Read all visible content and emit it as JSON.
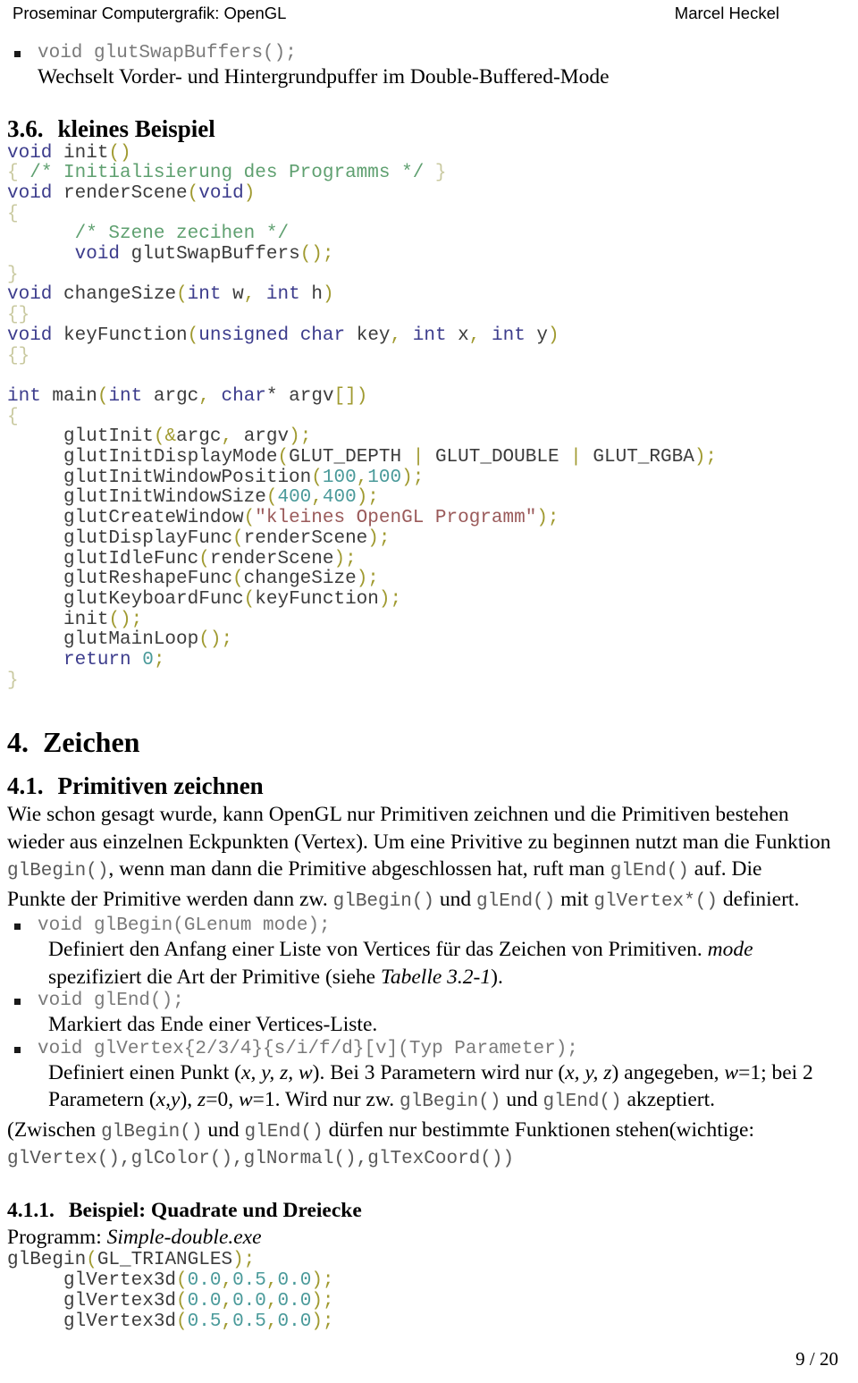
{
  "header": {
    "left": "Proseminar Computergrafik: OpenGL",
    "right": "Marcel Heckel"
  },
  "footer": {
    "page_indicator": "9 / 20"
  },
  "top_bullet": {
    "signature": "void glutSwapBuffers();",
    "description": "Wechselt Vorder- und Hintergrundpuffer im Double-Buffered-Mode"
  },
  "section_3_6": {
    "number": "3.6.",
    "title": "kleines Beispiel",
    "code_lines": [
      [
        {
          "t": "void",
          "c": "kw"
        },
        {
          "t": " ",
          "c": "plain"
        },
        {
          "t": "init",
          "c": "id"
        },
        {
          "t": "()",
          "c": "pun"
        }
      ],
      [
        {
          "t": "{",
          "c": "brc"
        },
        {
          "t": " ",
          "c": "plain"
        },
        {
          "t": "/* Initialisierung des Programms */",
          "c": "cmt"
        },
        {
          "t": " ",
          "c": "plain"
        },
        {
          "t": "}",
          "c": "brc"
        }
      ],
      [
        {
          "t": "void",
          "c": "kw"
        },
        {
          "t": " ",
          "c": "plain"
        },
        {
          "t": "renderScene",
          "c": "id"
        },
        {
          "t": "(",
          "c": "pun"
        },
        {
          "t": "void",
          "c": "kw"
        },
        {
          "t": ")",
          "c": "pun"
        }
      ],
      [
        {
          "t": "{",
          "c": "brc"
        }
      ],
      [
        {
          "t": "      ",
          "c": "plain"
        },
        {
          "t": "/* Szene zecihen */",
          "c": "cmt"
        }
      ],
      [
        {
          "t": "      ",
          "c": "plain"
        },
        {
          "t": "void",
          "c": "kw"
        },
        {
          "t": " ",
          "c": "plain"
        },
        {
          "t": "glutSwapBuffers",
          "c": "id"
        },
        {
          "t": "()",
          "c": "pun"
        },
        {
          "t": ";",
          "c": "pun"
        }
      ],
      [
        {
          "t": "}",
          "c": "brc"
        }
      ],
      [
        {
          "t": "void",
          "c": "kw"
        },
        {
          "t": " ",
          "c": "plain"
        },
        {
          "t": "changeSize",
          "c": "id"
        },
        {
          "t": "(",
          "c": "pun"
        },
        {
          "t": "int",
          "c": "kw"
        },
        {
          "t": " w",
          "c": "id"
        },
        {
          "t": ",",
          "c": "pun"
        },
        {
          "t": " ",
          "c": "plain"
        },
        {
          "t": "int",
          "c": "kw"
        },
        {
          "t": " h",
          "c": "id"
        },
        {
          "t": ")",
          "c": "pun"
        }
      ],
      [
        {
          "t": "{}",
          "c": "brc"
        }
      ],
      [
        {
          "t": "void",
          "c": "kw"
        },
        {
          "t": " ",
          "c": "plain"
        },
        {
          "t": "keyFunction",
          "c": "id"
        },
        {
          "t": "(",
          "c": "pun"
        },
        {
          "t": "unsigned",
          "c": "kw"
        },
        {
          "t": " ",
          "c": "plain"
        },
        {
          "t": "char",
          "c": "kw"
        },
        {
          "t": " key",
          "c": "id"
        },
        {
          "t": ",",
          "c": "pun"
        },
        {
          "t": " ",
          "c": "plain"
        },
        {
          "t": "int",
          "c": "kw"
        },
        {
          "t": " x",
          "c": "id"
        },
        {
          "t": ",",
          "c": "pun"
        },
        {
          "t": " ",
          "c": "plain"
        },
        {
          "t": "int",
          "c": "kw"
        },
        {
          "t": " y",
          "c": "id"
        },
        {
          "t": ")",
          "c": "pun"
        }
      ],
      [
        {
          "t": "{}",
          "c": "brc"
        }
      ],
      [
        {
          "t": "",
          "c": "plain"
        }
      ],
      [
        {
          "t": "int",
          "c": "kw"
        },
        {
          "t": " ",
          "c": "plain"
        },
        {
          "t": "main",
          "c": "id"
        },
        {
          "t": "(",
          "c": "pun"
        },
        {
          "t": "int",
          "c": "kw"
        },
        {
          "t": " argc",
          "c": "id"
        },
        {
          "t": ",",
          "c": "pun"
        },
        {
          "t": " ",
          "c": "plain"
        },
        {
          "t": "char",
          "c": "kw"
        },
        {
          "t": "*",
          "c": "id"
        },
        {
          "t": " argv",
          "c": "id"
        },
        {
          "t": "[]",
          "c": "pun"
        },
        {
          "t": ")",
          "c": "pun"
        }
      ],
      [
        {
          "t": "{",
          "c": "brc"
        }
      ],
      [
        {
          "t": "     ",
          "c": "plain"
        },
        {
          "t": "glutInit",
          "c": "id"
        },
        {
          "t": "(",
          "c": "pun"
        },
        {
          "t": "&",
          "c": "pun"
        },
        {
          "t": "argc",
          "c": "id"
        },
        {
          "t": ",",
          "c": "pun"
        },
        {
          "t": " argv",
          "c": "id"
        },
        {
          "t": ");",
          "c": "pun"
        }
      ],
      [
        {
          "t": "     ",
          "c": "plain"
        },
        {
          "t": "glutInitDisplayMode",
          "c": "id"
        },
        {
          "t": "(",
          "c": "pun"
        },
        {
          "t": "GLUT_DEPTH",
          "c": "id"
        },
        {
          "t": " ",
          "c": "plain"
        },
        {
          "t": "|",
          "c": "pun"
        },
        {
          "t": " ",
          "c": "plain"
        },
        {
          "t": "GLUT_DOUBLE",
          "c": "id"
        },
        {
          "t": " ",
          "c": "plain"
        },
        {
          "t": "|",
          "c": "pun"
        },
        {
          "t": " ",
          "c": "plain"
        },
        {
          "t": "GLUT_RGBA",
          "c": "id"
        },
        {
          "t": ");",
          "c": "pun"
        }
      ],
      [
        {
          "t": "     ",
          "c": "plain"
        },
        {
          "t": "glutInitWindowPosition",
          "c": "id"
        },
        {
          "t": "(",
          "c": "pun"
        },
        {
          "t": "100",
          "c": "num"
        },
        {
          "t": ",",
          "c": "pun"
        },
        {
          "t": "100",
          "c": "num"
        },
        {
          "t": ");",
          "c": "pun"
        }
      ],
      [
        {
          "t": "     ",
          "c": "plain"
        },
        {
          "t": "glutInitWindowSize",
          "c": "id"
        },
        {
          "t": "(",
          "c": "pun"
        },
        {
          "t": "400",
          "c": "num"
        },
        {
          "t": ",",
          "c": "pun"
        },
        {
          "t": "400",
          "c": "num"
        },
        {
          "t": ");",
          "c": "pun"
        }
      ],
      [
        {
          "t": "     ",
          "c": "plain"
        },
        {
          "t": "glutCreateWindow",
          "c": "id"
        },
        {
          "t": "(",
          "c": "pun"
        },
        {
          "t": "\"kleines OpenGL Programm\"",
          "c": "str"
        },
        {
          "t": ");",
          "c": "pun"
        }
      ],
      [
        {
          "t": "     ",
          "c": "plain"
        },
        {
          "t": "glutDisplayFunc",
          "c": "id"
        },
        {
          "t": "(",
          "c": "pun"
        },
        {
          "t": "renderScene",
          "c": "id"
        },
        {
          "t": ");",
          "c": "pun"
        }
      ],
      [
        {
          "t": "     ",
          "c": "plain"
        },
        {
          "t": "glutIdleFunc",
          "c": "id"
        },
        {
          "t": "(",
          "c": "pun"
        },
        {
          "t": "renderScene",
          "c": "id"
        },
        {
          "t": ");",
          "c": "pun"
        }
      ],
      [
        {
          "t": "     ",
          "c": "plain"
        },
        {
          "t": "glutReshapeFunc",
          "c": "id"
        },
        {
          "t": "(",
          "c": "pun"
        },
        {
          "t": "changeSize",
          "c": "id"
        },
        {
          "t": ");",
          "c": "pun"
        }
      ],
      [
        {
          "t": "     ",
          "c": "plain"
        },
        {
          "t": "glutKeyboardFunc",
          "c": "id"
        },
        {
          "t": "(",
          "c": "pun"
        },
        {
          "t": "keyFunction",
          "c": "id"
        },
        {
          "t": ");",
          "c": "pun"
        }
      ],
      [
        {
          "t": "     ",
          "c": "plain"
        },
        {
          "t": "init",
          "c": "id"
        },
        {
          "t": "();",
          "c": "pun"
        }
      ],
      [
        {
          "t": "     ",
          "c": "plain"
        },
        {
          "t": "glutMainLoop",
          "c": "id"
        },
        {
          "t": "();",
          "c": "pun"
        }
      ],
      [
        {
          "t": "     ",
          "c": "plain"
        },
        {
          "t": "return",
          "c": "kw"
        },
        {
          "t": " ",
          "c": "plain"
        },
        {
          "t": "0",
          "c": "num"
        },
        {
          "t": ";",
          "c": "pun"
        }
      ],
      [
        {
          "t": "}",
          "c": "brc"
        }
      ]
    ]
  },
  "section_4": {
    "number": "4.",
    "title": "Zeichen"
  },
  "section_4_1": {
    "number": "4.1.",
    "title": "Primitiven zeichnen",
    "paragraph": {
      "line1": "Wie schon gesagt wurde, kann OpenGL nur Primitiven zeichnen und die Primitiven bestehen",
      "line2_a": "wieder aus einzelnen Eckpunkten (Vertex). Um eine Privitive zu beginnen nutzt man die Funktion",
      "line3_code1": "glBegin()",
      "line3_a": ", wenn man dann die Primitive abgeschlossen hat, ruft man ",
      "line3_code2": "glEnd()",
      "line3_b": " auf. Die",
      "line4_a": "Punkte der Primitive werden dann zw. ",
      "line4_code1": "glBegin()",
      "line4_b": " und ",
      "line4_code2": "glEnd()",
      "line4_c": " mit ",
      "line4_code3": "glVertex*()",
      "line4_d": " definiert."
    },
    "bullets": [
      {
        "signature": "void glBegin(GLenum mode);",
        "desc_a": "Definiert den Anfang einer Liste von Vertices für das Zeichen von Primitiven. ",
        "desc_italic1": "mode",
        "desc_b": "spezifiziert die Art der Primitive (siehe ",
        "desc_italic2": "Tabelle 3.2-1",
        "desc_c": ")."
      },
      {
        "signature": "void glEnd();",
        "desc_a": "Markiert das Ende einer Vertices-Liste.",
        "desc_italic1": "",
        "desc_b": "",
        "desc_italic2": "",
        "desc_c": ""
      },
      {
        "signature": "void glVertex{2/3/4}{s/i/f/d}[v](Typ Parameter);",
        "desc_a": "Definiert einen Punkt (",
        "desc_italic1": "x, y, z, w",
        "desc_b": "). Bei 3 Parametern wird nur (",
        "desc_italic2": "x, y, z",
        "desc_c": ") angegeben, "
      }
    ],
    "vertex_detail": {
      "w_eq": "w",
      "w_val": "=1; bei 2",
      "line2_a": "Parametern (",
      "line2_italic": "x,y",
      "line2_b": "), ",
      "line2_italic2": "z",
      "line2_c": "=0, ",
      "line2_italic3": "w",
      "line2_d": "=1. Wird nur zw. ",
      "line2_code1": "glBegin()",
      "line2_e": " und ",
      "line2_code2": "glEnd()",
      "line2_f": " akzeptiert."
    },
    "note": {
      "a": "(Zwischen ",
      "code1": "glBegin()",
      "b": " und ",
      "code2": "glEnd()",
      "c": " dürfen nur bestimmte Funktionen stehen(wichtige:",
      "code_list": "glVertex(),glColor(),glNormal(),glTexCoord())"
    }
  },
  "section_4_1_1": {
    "number": "4.1.1.",
    "title": "Beispiel: Quadrate und Dreiecke",
    "program_label": "Programm: ",
    "program_name": "Simple-double.exe",
    "code_lines": [
      [
        {
          "t": "glBegin",
          "c": "id"
        },
        {
          "t": "(",
          "c": "pun"
        },
        {
          "t": "GL_TRIANGLES",
          "c": "id"
        },
        {
          "t": ");",
          "c": "pun"
        }
      ],
      [
        {
          "t": "     ",
          "c": "plain"
        },
        {
          "t": "glVertex3d",
          "c": "id"
        },
        {
          "t": "(",
          "c": "pun"
        },
        {
          "t": "0.0",
          "c": "num"
        },
        {
          "t": ",",
          "c": "pun"
        },
        {
          "t": "0.5",
          "c": "num"
        },
        {
          "t": ",",
          "c": "pun"
        },
        {
          "t": "0.0",
          "c": "num"
        },
        {
          "t": ");",
          "c": "pun"
        }
      ],
      [
        {
          "t": "     ",
          "c": "plain"
        },
        {
          "t": "glVertex3d",
          "c": "id"
        },
        {
          "t": "(",
          "c": "pun"
        },
        {
          "t": "0.0",
          "c": "num"
        },
        {
          "t": ",",
          "c": "pun"
        },
        {
          "t": "0.0",
          "c": "num"
        },
        {
          "t": ",",
          "c": "pun"
        },
        {
          "t": "0.0",
          "c": "num"
        },
        {
          "t": ");",
          "c": "pun"
        }
      ],
      [
        {
          "t": "     ",
          "c": "plain"
        },
        {
          "t": "glVertex3d",
          "c": "id"
        },
        {
          "t": "(",
          "c": "pun"
        },
        {
          "t": "0.5",
          "c": "num"
        },
        {
          "t": ",",
          "c": "pun"
        },
        {
          "t": "0.5",
          "c": "num"
        },
        {
          "t": ",",
          "c": "pun"
        },
        {
          "t": "0.0",
          "c": "num"
        },
        {
          "t": ");",
          "c": "pun"
        }
      ]
    ]
  },
  "colors": {
    "keyword": "#3c3c8c",
    "identifier": "#3c3c3c",
    "punctuation": "#a09a30",
    "number": "#4a9a9a",
    "string": "#9a5a5a",
    "comment": "#5fa070",
    "brace": "#c9c9a0"
  }
}
